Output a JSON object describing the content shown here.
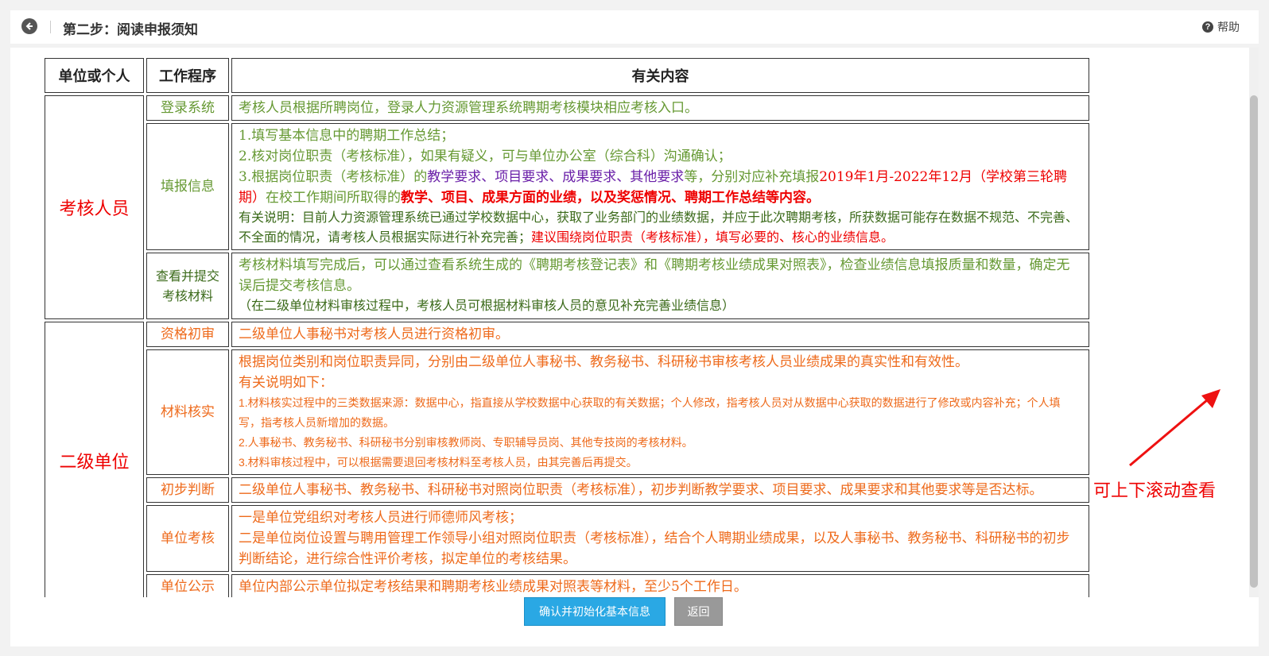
{
  "header": {
    "title": "第二步：阅读申报须知",
    "help_label": "帮助"
  },
  "table": {
    "col1": "单位或个人",
    "col2": "工作程序",
    "col3": "有关内容",
    "group1": "考核人员",
    "group2": "二级单位",
    "rows": {
      "login": {
        "proc": "登录系统",
        "text": "考核人员根据所聘岗位，登录人力资源管理系统聘期考核模块相应考核入口。"
      },
      "fill": {
        "proc": "填报信息",
        "l1": "1.填写基本信息中的聘期工作总结；",
        "l2": "2.核对岗位职责（考核标准），如果有疑义，可与单位办公室（综合科）沟通确认；",
        "l3a": "3.根据岗位职责（考核标准）的",
        "l3b": "教学要求、项目要求、成果要求、其他要求",
        "l3c": "等，分别对应补充填报",
        "l3d": "2019年1月-2022年12月（学校第三轮聘期）",
        "l3e": "在校工作期间所取得的",
        "l3f": "教学、项目、成果方面的业绩，以及奖惩情况、聘期工作总结等内容。",
        "note_a": "有关说明：目前人力资源管理系统已通过学校数据中心，获取了业务部门的业绩数据，并应于此次聘期考核，所获数据可能存在数据不规范、不完善、不全面的情况，请考核人员根据实际进行补充完善；",
        "note_b": "建议围绕岗位职责（考核标准），填写必要的、核心的业绩信息。"
      },
      "submit": {
        "proc": "查看并提交考核材料",
        "text": "考核材料填写完成后，可以通过查看系统生成的《聘期考核登记表》和《聘期考核业绩成果对照表》，检查业绩信息填报质量和数量，确定无误后提交考核信息。",
        "note": "（在二级单位材料审核过程中，考核人员可根据材料审核人员的意见补充完善业绩信息）"
      },
      "qualify": {
        "proc": "资格初审",
        "text": "二级单位人事秘书对考核人员进行资格初审。"
      },
      "verify": {
        "proc": "材料核实",
        "l1": "根据岗位类别和岗位职责异同，分别由二级单位人事秘书、教务秘书、科研秘书审核考核人员业绩成果的真实性和有效性。",
        "l2": "有关说明如下：",
        "l3": "1.材料核实过程中的三类数据来源：数据中心，指直接从学校数据中心获取的有关数据；个人修改，指考核人员对从数据中心获取的数据进行了修改或内容补充；个人填写，指考核人员新增加的数据。",
        "l4": "2.人事秘书、教务秘书、科研秘书分别审核教师岗、专职辅导员岗、其他专技岗的考核材料。",
        "l5": "3.材料审核过程中，可以根据需要退回考核材料至考核人员，由其完善后再提交。"
      },
      "judge": {
        "proc": "初步判断",
        "text": "二级单位人事秘书、教务秘书、科研秘书对照岗位职责（考核标准），初步判断教学要求、项目要求、成果要求和其他要求等是否达标。"
      },
      "assess": {
        "proc": "单位考核",
        "l1": "一是单位党组织对考核人员进行师德师风考核；",
        "l2": "二是单位岗位设置与聘用管理工作领导小组对照岗位职责（考核标准），结合个人聘期业绩成果，以及人事秘书、教务秘书、科研秘书的初步判断结论，进行综合性评价考核，拟定单位的考核结果。"
      },
      "publicity": {
        "proc": "单位公示",
        "text": "单位内部公示单位拟定考核结果和聘期考核业绩成果对照表等材料，至少5个工作日。"
      }
    }
  },
  "annotation": "可上下滚动查看",
  "footer": {
    "confirm_label": "确认并初始化基本信息",
    "back_label": "返回"
  },
  "colors": {
    "green": "#669933",
    "orange": "#ee6a1b",
    "red": "#e00000",
    "purple": "#6a1fa8",
    "confirm_bg": "#2aa8e4"
  }
}
